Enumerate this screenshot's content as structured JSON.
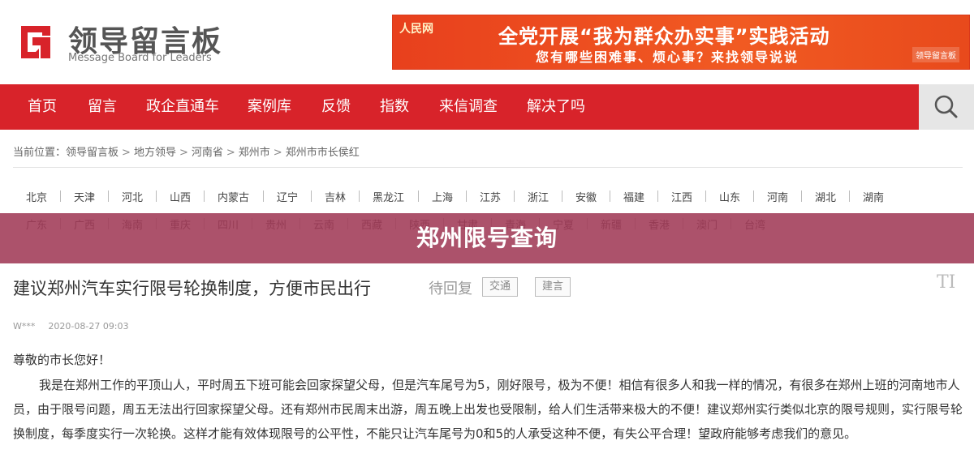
{
  "header": {
    "logo_title": "领导留言板",
    "logo_subtitle": "Message Board for Leaders",
    "banner": {
      "brand": "人民网",
      "line1": "全党开展“我为群众办实事”实践活动",
      "line2": "您有哪些困难事、烦心事？来找领导说说",
      "badge": "领导留言板"
    }
  },
  "nav": {
    "items": [
      "首页",
      "留言",
      "政企直通车",
      "案例库",
      "反馈",
      "指数",
      "来信调查",
      "解决了吗"
    ]
  },
  "breadcrumb": {
    "label": "当前位置：",
    "items": [
      "领导留言板",
      "地方领导",
      "河南省",
      "郑州市",
      "郑州市市长侯红"
    ]
  },
  "regions": {
    "row1": [
      "北京",
      "天津",
      "河北",
      "山西",
      "内蒙古",
      "辽宁",
      "吉林",
      "黑龙江",
      "上海",
      "江苏",
      "浙江",
      "安徽",
      "福建",
      "江西",
      "山东",
      "河南",
      "湖北",
      "湖南"
    ],
    "row2": [
      "广东",
      "广西",
      "海南",
      "重庆",
      "四川",
      "贵州",
      "云南",
      "西藏",
      "陕西",
      "甘肃",
      "青海",
      "宁夏",
      "新疆",
      "香港",
      "澳门",
      "台湾"
    ]
  },
  "overlay": {
    "title": "郑州限号查询"
  },
  "article": {
    "title": "建议郑州汽车实行限号轮换制度，方便市民出行",
    "status": "待回复",
    "tags": [
      "交通",
      "建言"
    ],
    "corner_mark": "TI",
    "author": "W***",
    "date": "2020-08-27 09:03",
    "salutation": "尊敬的市长您好！",
    "body": "我是在郑州工作的平顶山人，平时周五下班可能会回家探望父母，但是汽车尾号为5，刚好限号，极为不便！相信有很多人和我一样的情况，有很多在郑州上班的河南地市人员，由于限号问题，周五无法出行回家探望父母。还有郑州市民周末出游，周五晚上出发也受限制，给人们生活带来极大的不便！建议郑州实行类似北京的限号规则，实行限号轮换制度，每季度实行一次轮换。这样才能有效体现限号的公平性，不能只让汽车尾号为0和5的人承受这种不便，有失公平合理！望政府能够考虑我们的意见。"
  },
  "colors": {
    "nav_bg": "#d8232a",
    "banner_bg": "#f15a22",
    "overlay_bg": "#a03a56",
    "logo_red": "#d8232a"
  }
}
